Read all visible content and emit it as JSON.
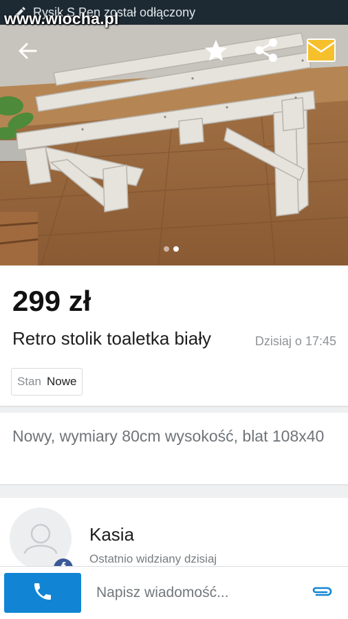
{
  "status_bar": {
    "notification": "Rysik S Pen został odłączony",
    "watermark": "www.wiocha.pl"
  },
  "gallery": {
    "icons": [
      "back-arrow-icon",
      "star-icon",
      "share-icon",
      "mail-icon"
    ],
    "pages": 2,
    "active_page": 2
  },
  "listing": {
    "price": "299 zł",
    "title": "Retro stolik toaletka biały",
    "date": "Dzisiaj o 17:45",
    "params": [
      {
        "key": "Stan",
        "value": "Nowe"
      }
    ],
    "description": "Nowy, wymiary 80cm wysokość, blat 108x40"
  },
  "seller": {
    "name": "Kasia",
    "last_seen": "Ostatnio widziany dzisiaj",
    "badge_letter": "f"
  },
  "bottom_bar": {
    "message_placeholder": "Napisz wiadomość...",
    "icons": [
      "phone-icon",
      "paperclip-icon"
    ]
  },
  "colors": {
    "accent": "#1185d3",
    "status_bar": "#1e2a33",
    "facebook": "#3b5998"
  }
}
